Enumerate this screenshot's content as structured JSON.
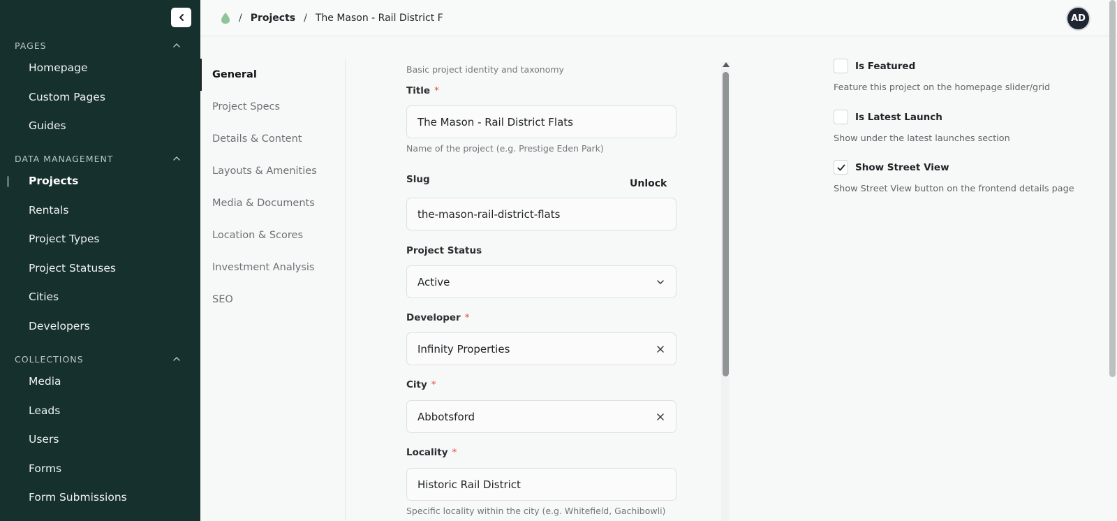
{
  "sidebar": {
    "sections": [
      {
        "title": "PAGES",
        "items": [
          "Homepage",
          "Custom Pages",
          "Guides"
        ]
      },
      {
        "title": "DATA MANAGEMENT",
        "items": [
          "Projects",
          "Rentals",
          "Project Types",
          "Project Statuses",
          "Cities",
          "Developers"
        ]
      },
      {
        "title": "COLLECTIONS",
        "items": [
          "Media",
          "Leads",
          "Users",
          "Forms",
          "Form Submissions"
        ]
      }
    ],
    "active_item": "Projects"
  },
  "topbar": {
    "crumb_sep": "/",
    "crumb_projects": "Projects",
    "crumb_current": "The Mason - Rail District F",
    "avatar_initials": "AD"
  },
  "tabs": [
    "General",
    "Project Specs",
    "Details & Content",
    "Layouts & Amenities",
    "Media & Documents",
    "Location & Scores",
    "Investment Analysis",
    "SEO"
  ],
  "active_tab": "General",
  "form": {
    "section_hint": "Basic project identity and taxonomy",
    "title": {
      "label": "Title",
      "value": "The Mason - Rail District Flats",
      "hint": "Name of the project (e.g. Prestige Eden Park)"
    },
    "slug": {
      "label": "Slug",
      "value": "the-mason-rail-district-flats",
      "unlock_label": "Unlock"
    },
    "status": {
      "label": "Project Status",
      "value": "Active"
    },
    "developer": {
      "label": "Developer",
      "value": "Infinity Properties"
    },
    "city": {
      "label": "City",
      "value": "Abbotsford"
    },
    "locality": {
      "label": "Locality",
      "value": "Historic Rail District",
      "hint": "Specific locality within the city (e.g. Whitefield, Gachibowli)"
    },
    "required_mark": "*"
  },
  "options": [
    {
      "label": "Is Featured",
      "description": "Feature this project on the homepage slider/grid",
      "checked": false
    },
    {
      "label": "Is Latest Launch",
      "description": "Show under the latest launches section",
      "checked": false
    },
    {
      "label": "Show Street View",
      "description": "Show Street View button on the frontend details page",
      "checked": true
    }
  ],
  "colors": {
    "sidebar_bg": "#16302e",
    "leaf_icon": "#8fc49a",
    "required": "#e04848"
  }
}
